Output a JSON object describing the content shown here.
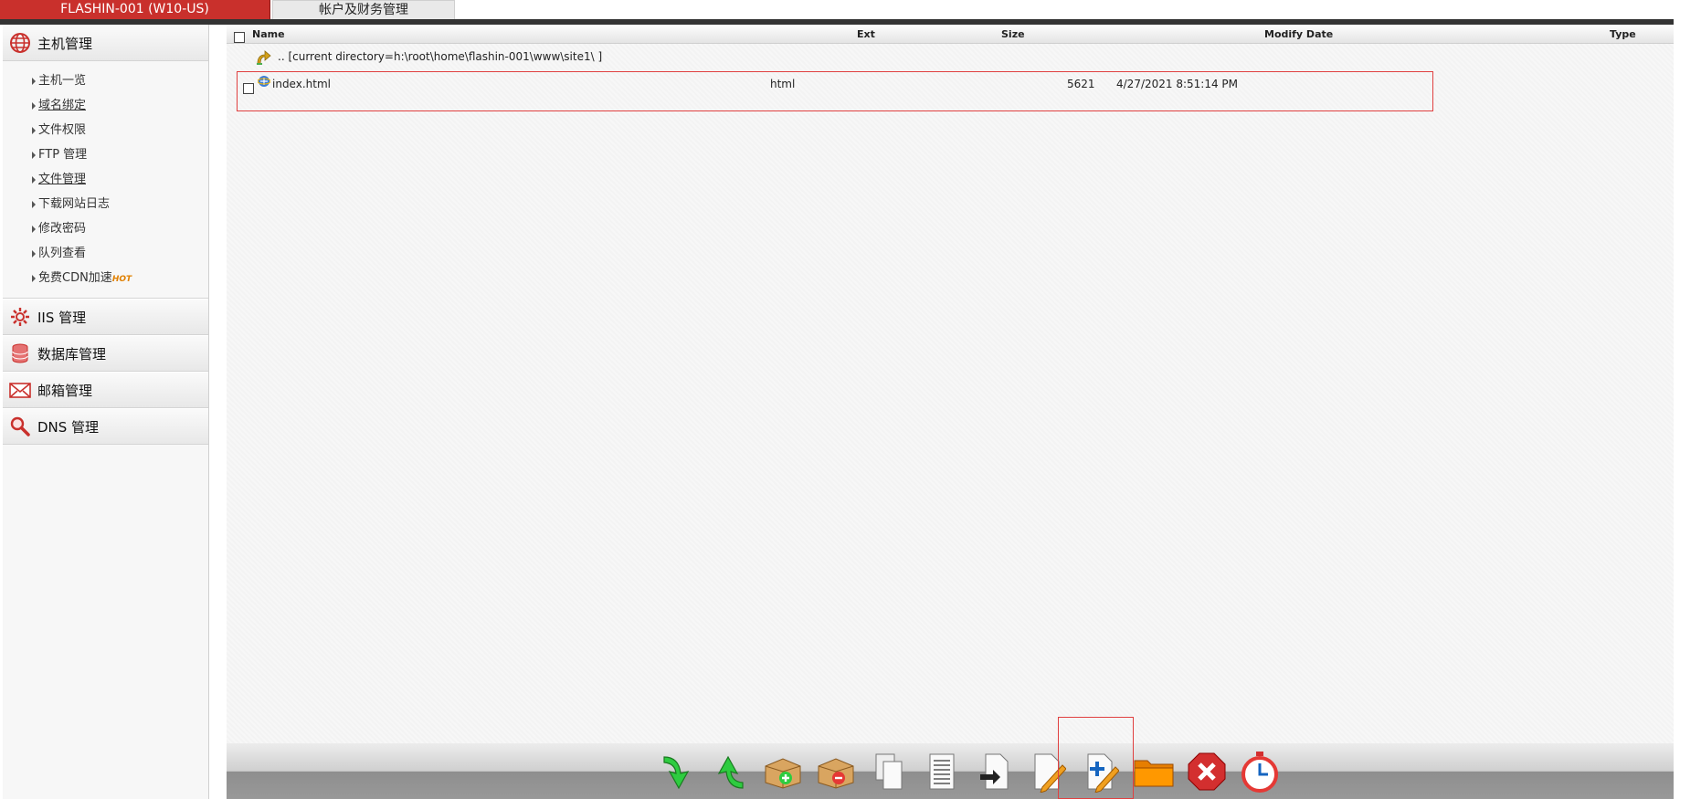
{
  "tabs": {
    "active": "FLASHIN-001 (W10-US)",
    "inactive": "帐户及财务管理"
  },
  "sidebar": {
    "host": {
      "title": "主机管理",
      "items": [
        {
          "label": "主机一览"
        },
        {
          "label": "域名绑定"
        },
        {
          "label": "文件权限"
        },
        {
          "label": "FTP 管理"
        },
        {
          "label": "文件管理"
        },
        {
          "label": "下载网站日志"
        },
        {
          "label": "修改密码"
        },
        {
          "label": "队列查看"
        },
        {
          "label": "免费CDN加速",
          "badge": "HOT"
        }
      ]
    },
    "iis": {
      "title": "IIS 管理"
    },
    "db": {
      "title": "数据库管理"
    },
    "mail": {
      "title": "邮箱管理"
    },
    "dns": {
      "title": "DNS 管理"
    }
  },
  "table": {
    "headers": {
      "name": "Name",
      "ext": "Ext",
      "size": "Size",
      "date": "Modify Date",
      "type": "Type"
    },
    "parent_dir": ".. [current directory=h:\\root\\home\\flashin-001\\www\\site1\\ ]",
    "rows": [
      {
        "name": "index.html",
        "ext": "html",
        "size": "5621",
        "date": "4/27/2021 8:51:14 PM"
      }
    ]
  },
  "toolbar": {
    "buttons": [
      "move-down-icon",
      "move-up-icon",
      "add-box-icon",
      "remove-box-icon",
      "copy-icon",
      "document-icon",
      "import-icon",
      "edit-icon",
      "new-file-icon",
      "folder-icon",
      "delete-icon",
      "scheduler-icon"
    ]
  },
  "colors": {
    "accent": "#c9302c",
    "highlight": "#e04040"
  }
}
